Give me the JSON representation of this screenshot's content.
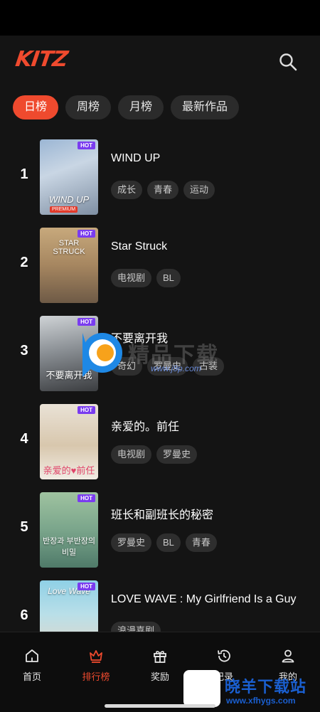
{
  "app": {
    "logo_text": "KITZ"
  },
  "colors": {
    "accent": "#ef4a2e",
    "hot_badge": "#7a3cf0",
    "background": "#141414"
  },
  "tabs": [
    {
      "label": "日榜",
      "active": true
    },
    {
      "label": "周榜",
      "active": false
    },
    {
      "label": "月榜",
      "active": false
    },
    {
      "label": "最新作品",
      "active": false
    }
  ],
  "rankings": [
    {
      "rank": "1",
      "title": "WIND UP",
      "poster_text": "WIND UP",
      "badge": "HOT",
      "premium": "PREMIUM",
      "tags": [
        "成长",
        "青春",
        "运动"
      ]
    },
    {
      "rank": "2",
      "title": "Star Struck",
      "poster_text": "STAR STRUCK",
      "badge": "HOT",
      "tags": [
        "电视剧",
        "BL"
      ]
    },
    {
      "rank": "3",
      "title": "不要离开我",
      "poster_text": "不要离开我",
      "badge": "HOT",
      "tags": [
        "奇幻",
        "罗曼史",
        "古装"
      ]
    },
    {
      "rank": "4",
      "title": "亲爱的。前任",
      "poster_text": "亲爱的♥前任",
      "badge": "HOT",
      "tags": [
        "电视剧",
        "罗曼史"
      ]
    },
    {
      "rank": "5",
      "title": "班长和副班长的秘密",
      "poster_text": "반장과 부반장의 비밀",
      "badge": "HOT",
      "tags": [
        "罗曼史",
        "BL",
        "青春"
      ]
    },
    {
      "rank": "6",
      "title": "LOVE WAVE : My Girlfriend Is a Guy",
      "poster_text": "Love Wave",
      "badge": "HOT",
      "tags": [
        "浪漫喜剧"
      ]
    }
  ],
  "bottom_nav": [
    {
      "label": "首页",
      "icon": "home-icon",
      "active": false
    },
    {
      "label": "排行榜",
      "icon": "crown-icon",
      "active": true
    },
    {
      "label": "奖励",
      "icon": "gift-icon",
      "active": false
    },
    {
      "label": "记录",
      "icon": "history-icon",
      "active": false
    },
    {
      "label": "我的",
      "icon": "user-icon",
      "active": false
    }
  ],
  "watermarks": {
    "center_text": "精品下载",
    "center_url": "www.j9p.com",
    "corner_text": "晓羊下载站",
    "corner_url": "www.xfhygs.com"
  }
}
